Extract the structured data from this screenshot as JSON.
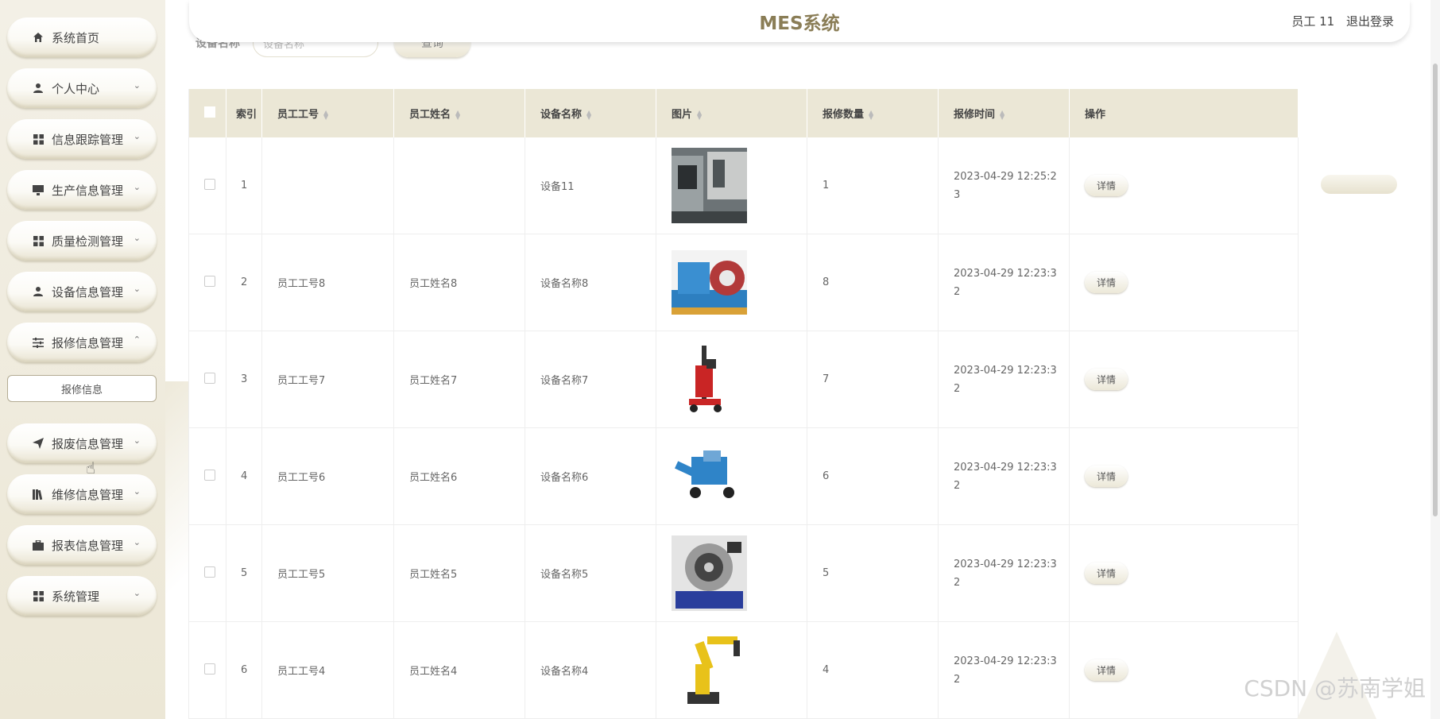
{
  "header": {
    "title": "MES系统",
    "user": "员工 11",
    "logout": "退出登录"
  },
  "search": {
    "label": "设备名称",
    "placeholder": "设备名称",
    "button": "查询"
  },
  "sidebar": {
    "items": [
      {
        "label": "系统首页",
        "icon": "home-icon"
      },
      {
        "label": "个人中心",
        "icon": "user-icon"
      },
      {
        "label": "信息跟踪管理",
        "icon": "grid-icon"
      },
      {
        "label": "生产信息管理",
        "icon": "monitor-icon"
      },
      {
        "label": "质量检测管理",
        "icon": "grid-icon"
      },
      {
        "label": "设备信息管理",
        "icon": "user-icon"
      },
      {
        "label": "报修信息管理",
        "icon": "sliders-icon"
      },
      {
        "label": "报废信息管理",
        "icon": "send-icon"
      },
      {
        "label": "维修信息管理",
        "icon": "book-icon"
      },
      {
        "label": "报表信息管理",
        "icon": "briefcase-icon"
      },
      {
        "label": "系统管理",
        "icon": "grid-icon"
      }
    ],
    "sub_item": "报修信息"
  },
  "table": {
    "headers": [
      "索引",
      "员工工号",
      "员工姓名",
      "设备名称",
      "图片",
      "报修数量",
      "报修时间",
      "操作"
    ],
    "rows": [
      {
        "index": "1",
        "emp_no": "",
        "emp_name": "",
        "device": "设备11",
        "qty": "1",
        "time": "2023-04-29 12:25:23",
        "action": "详情"
      },
      {
        "index": "2",
        "emp_no": "员工工号8",
        "emp_name": "员工姓名8",
        "device": "设备名称8",
        "qty": "8",
        "time": "2023-04-29 12:23:32",
        "action": "详情"
      },
      {
        "index": "3",
        "emp_no": "员工工号7",
        "emp_name": "员工姓名7",
        "device": "设备名称7",
        "qty": "7",
        "time": "2023-04-29 12:23:32",
        "action": "详情"
      },
      {
        "index": "4",
        "emp_no": "员工工号6",
        "emp_name": "员工姓名6",
        "device": "设备名称6",
        "qty": "6",
        "time": "2023-04-29 12:23:32",
        "action": "详情"
      },
      {
        "index": "5",
        "emp_no": "员工工号5",
        "emp_name": "员工姓名5",
        "device": "设备名称5",
        "qty": "5",
        "time": "2023-04-29 12:23:32",
        "action": "详情"
      },
      {
        "index": "6",
        "emp_no": "员工工号4",
        "emp_name": "员工姓名4",
        "device": "设备名称4",
        "qty": "4",
        "time": "2023-04-29 12:23:32",
        "action": "详情"
      }
    ]
  },
  "watermark": "CSDN @苏南学姐",
  "colors": {
    "accent": "#8a7d56",
    "header_bg": "#ebe7d6",
    "sidebar_bg": "#f3f0e6"
  }
}
